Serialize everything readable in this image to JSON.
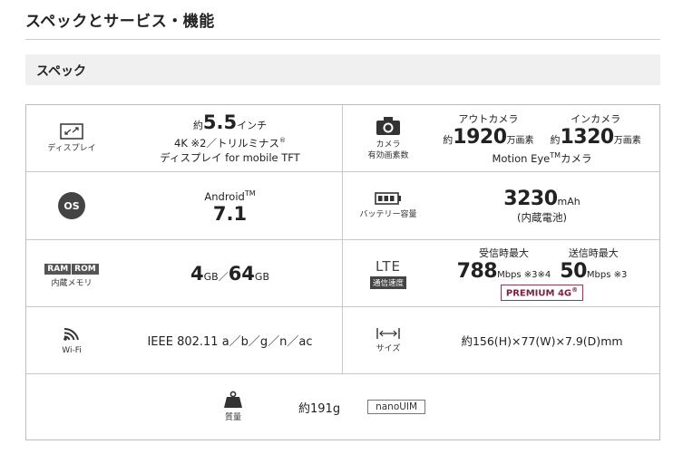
{
  "page": {
    "title": "スペックとサービス・機能",
    "section": "スペック"
  },
  "display": {
    "label": "ディスプレイ",
    "prefix": "約",
    "size": "5.5",
    "unit": "インチ",
    "line2": "4K ※2／トリルミナス",
    "reg": "®",
    "line3": "ディスプレイ for mobile TFT"
  },
  "camera": {
    "label1": "カメラ",
    "label2": "有効画素数",
    "out_label": "アウトカメラ",
    "in_label": "インカメラ",
    "prefix": "約",
    "out_value": "1920",
    "in_value": "1320",
    "unit": "万画素",
    "extra": "Motion Eye",
    "tm": "TM",
    "extra2": "カメラ"
  },
  "os": {
    "icon_text": "OS",
    "name": "Android",
    "tm": "TM",
    "version": "7.1"
  },
  "battery": {
    "label": "バッテリー容量",
    "value": "3230",
    "unit": "mAh",
    "note": "(内蔵電池)"
  },
  "memory": {
    "ram": "RAM",
    "rom": "ROM",
    "label": "内蔵メモリ",
    "ram_value": "4",
    "ram_unit": "GB",
    "sep": "／",
    "rom_value": "64",
    "rom_unit": "GB"
  },
  "lte": {
    "text": "LTE",
    "badge": "通信速度",
    "down_label": "受信時最大",
    "up_label": "送信時最大",
    "down_value": "788",
    "down_unit": "Mbps ※3※4",
    "up_value": "50",
    "up_unit": "Mbps ※3",
    "premium": "PREMIUM 4G",
    "reg": "®"
  },
  "wifi": {
    "label": "Wi-Fi",
    "value": "IEEE 802.11 a／b／g／n／ac"
  },
  "size": {
    "label": "サイズ",
    "value": "約156(H)×77(W)×7.9(D)mm"
  },
  "weight": {
    "label": "質量",
    "value": "約191g",
    "sim": "nanoUIM"
  }
}
